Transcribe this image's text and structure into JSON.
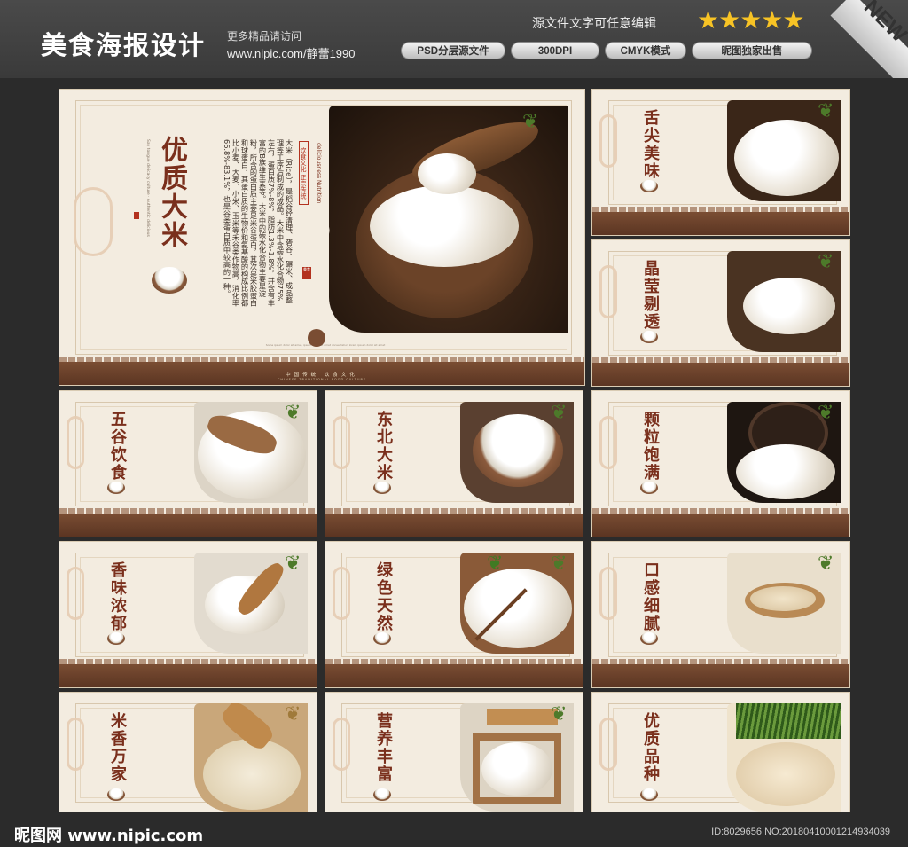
{
  "header": {
    "brand": "美食海报设计",
    "more_label": "更多精品请访问",
    "site": "www.nipic.com/静蕾1990",
    "edit_note": "源文件文字可任意编辑",
    "stars": "★★★★★",
    "badges": [
      "PSD分层源文件",
      "300DPI",
      "CMYK模式",
      "昵图独家出售"
    ],
    "new_label": "NEW"
  },
  "main_poster": {
    "title": "优质大米",
    "subtitle_en": "Say tongue delicacy culture · Authentic delicious",
    "body": "大米（Rice），是稻谷经清理、砻谷、碾米、成品整理等工序后制成的成品。大米中含碳水化合物75%左右，蛋白质7%-8%，脂肪1.3%-1.8%，并含有丰富的B族维生素等。大米中的碳水化合物主要是淀粉，所含的蛋白质主要是米谷蛋白，其次是米胶蛋白和球蛋白，其蛋白质的生物价和氨基酸的构成比例都比小麦、大麦、小米、玉米等禾谷类作物高，消化率66.8%-83.1%，也是谷类蛋白质中较高的一种。",
    "badge_top": "饮食文化 正宗传统",
    "badge_en": "deliciousness Nutrition",
    "seal_text": "美食",
    "strip_text": "中国传统 饮食文化",
    "strip_en": "CHINESE TRADITIONAL FOOD CULTURE",
    "small_print": "Some ipsum dolor sit amet, ipsum dolor sit amet consectetur, lorem ipsum dolor sit amet"
  },
  "posters": [
    {
      "title": "舌尖美味"
    },
    {
      "title": "晶莹剔透"
    },
    {
      "title": "五谷饮食"
    },
    {
      "title": "东北大米"
    },
    {
      "title": "颗粒饱满"
    },
    {
      "title": "香味浓郁"
    },
    {
      "title": "绿色天然"
    },
    {
      "title": "口感细腻"
    },
    {
      "title": "米香万家"
    },
    {
      "title": "营养丰富"
    },
    {
      "title": "优质品种"
    }
  ],
  "footer": {
    "logo": "昵图网 www.nipic.com",
    "id": "ID:8029656 NO:20180410001214934039"
  },
  "colors": {
    "background": "#2b2b2b",
    "poster_bg": "#f3ece0",
    "title_red": "#7a2f1c",
    "strip_brown": "#5b3522",
    "seal_red": "#b3321f",
    "star_gold": "#f7c325"
  }
}
